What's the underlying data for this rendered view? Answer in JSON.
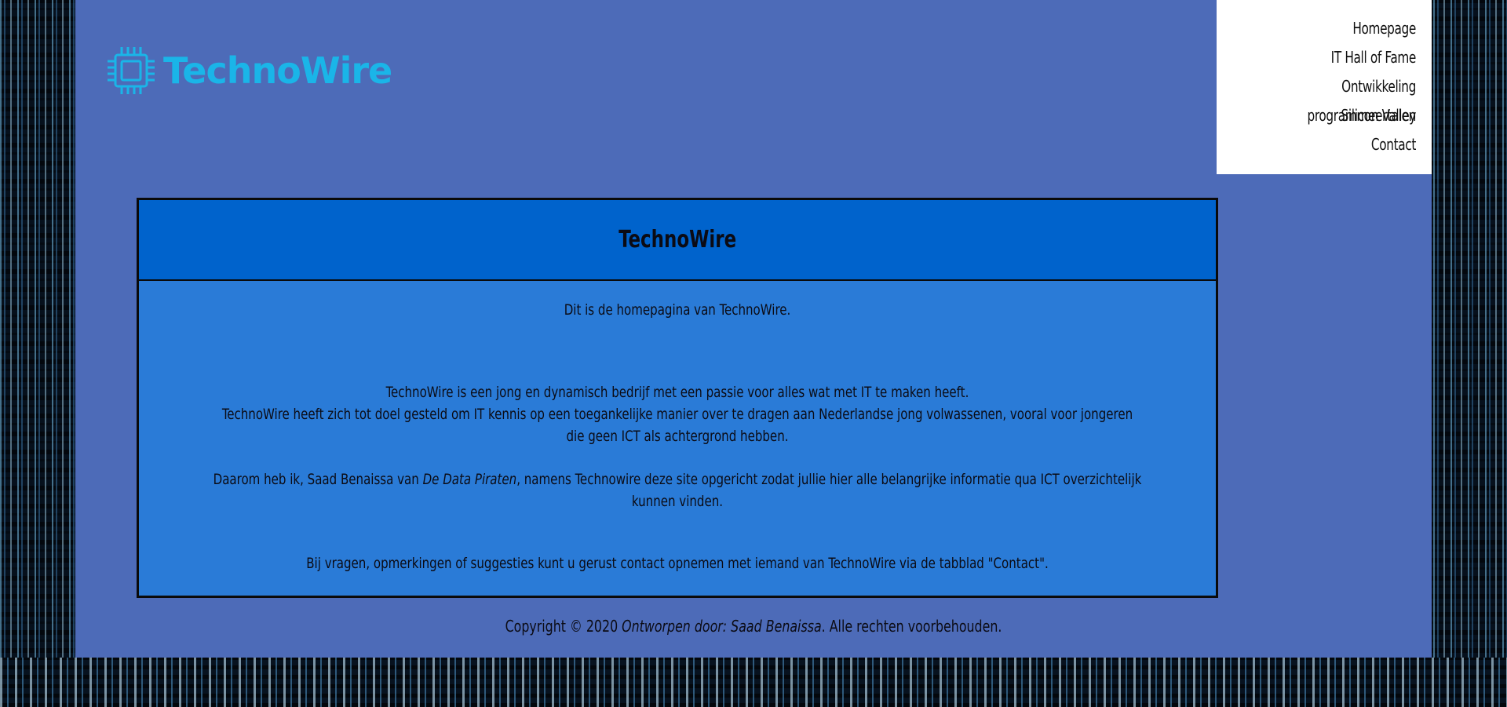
{
  "brand": {
    "name": "TechnoWire",
    "logo_icon": "chip-icon",
    "logo_color": "#1ab5e8"
  },
  "nav": {
    "items": [
      {
        "label": "Homepage"
      },
      {
        "label": "IT Hall of Fame"
      },
      {
        "label": "Ontwikkeling programmeertalen"
      },
      {
        "label": "Silicon Valley"
      },
      {
        "label": "Contact"
      }
    ]
  },
  "card": {
    "title": "TechnoWire",
    "intro": "Dit is de homepagina van TechnoWire.",
    "line1": "TechnoWire is een jong en dynamisch bedrijf met een passie voor alles wat met IT te maken heeft.",
    "line2": "TechnoWire heeft zich tot doel gesteld om IT kennis op een toegankelijke manier over te dragen aan Nederlandse jong volwassenen, vooral voor jongeren die geen ICT als achtergrond hebben.",
    "daarom_before": "Daarom heb ik, Saad Benaissa van ",
    "daarom_em": "De Data Piraten",
    "daarom_after": ", namens Technowire deze site opgericht zodat jullie hier alle belangrijke informatie qua ICT overzichtelijk kunnen vinden.",
    "vragen": "Bij vragen, opmerkingen of suggesties kunt u gerust contact opnemen met iemand van TechnoWire via de tabblad \"Contact\"."
  },
  "footer": {
    "before": "Copyright © 2020 ",
    "em": "Ontworpen door: Saad Benaissa",
    "after": ". Alle rechten voorbehouden."
  },
  "colors": {
    "page_bg": "#4d6bb8",
    "card_header": "#0063cc",
    "card_body": "#2a7bd7",
    "nav_bg": "#ffffff"
  }
}
